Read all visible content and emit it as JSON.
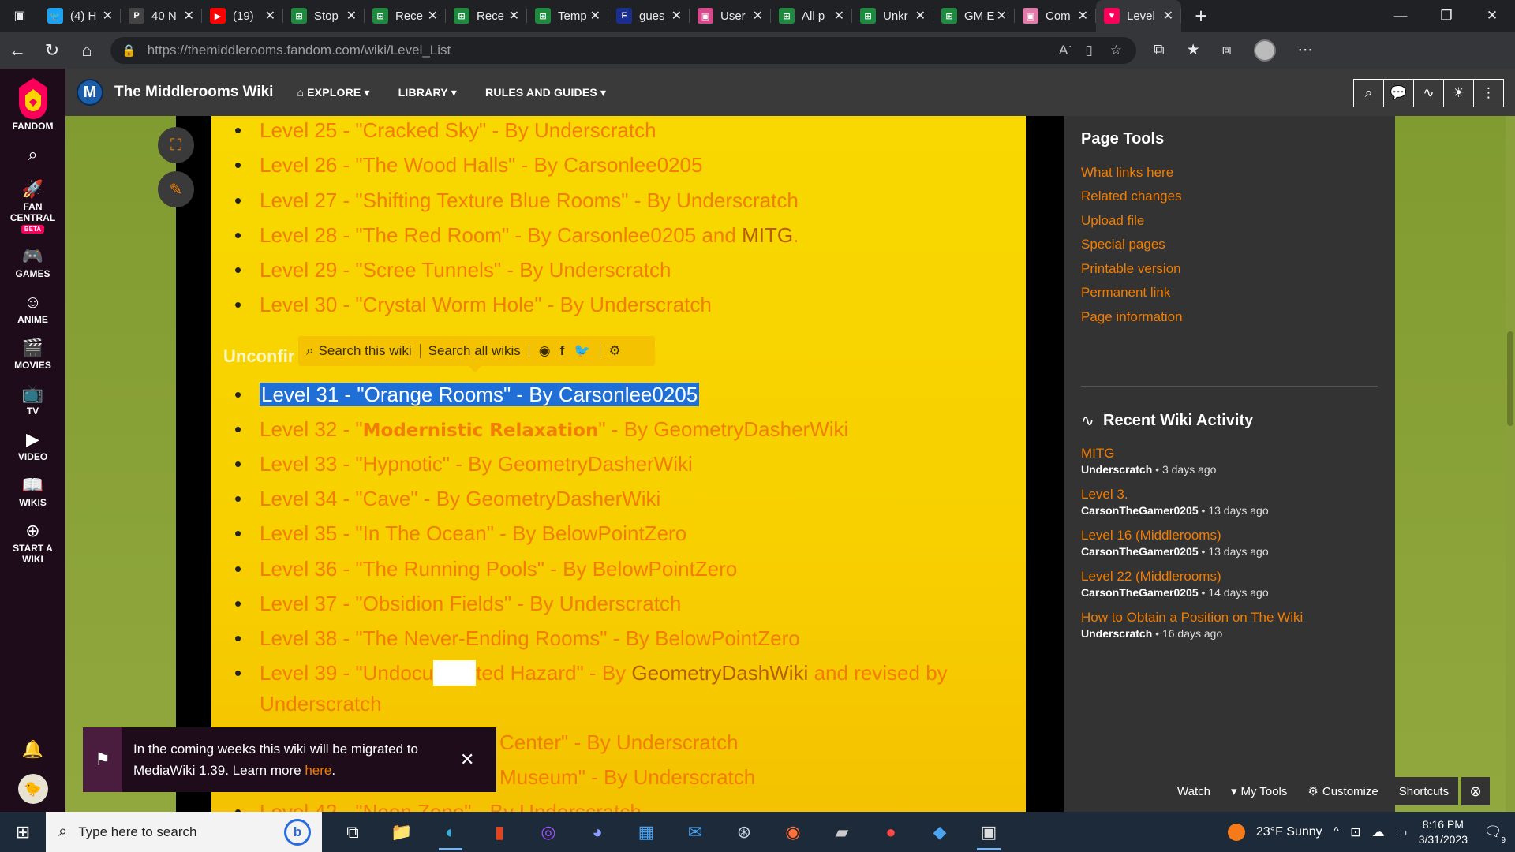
{
  "browser": {
    "tabs": [
      {
        "title": "(4) H",
        "favicon": "twitter-icon",
        "color": "#1da1f2",
        "glyph": "🐦"
      },
      {
        "title": "40 N",
        "favicon": "patreon-icon",
        "color": "#444",
        "glyph": "P"
      },
      {
        "title": "(19)",
        "favicon": "youtube-icon",
        "color": "#ff0000",
        "glyph": "▶"
      },
      {
        "title": "Stop",
        "favicon": "sheet-icon",
        "color": "#1f8a3f",
        "glyph": "⊞"
      },
      {
        "title": "Rece",
        "favicon": "sheet-icon",
        "color": "#1f8a3f",
        "glyph": "⊞"
      },
      {
        "title": "Rece",
        "favicon": "sheet-icon",
        "color": "#1f8a3f",
        "glyph": "⊞"
      },
      {
        "title": "Temp",
        "favicon": "sheet-icon",
        "color": "#1f8a3f",
        "glyph": "⊞"
      },
      {
        "title": "gues",
        "favicon": "fandom-tab-icon",
        "color": "#1a2f8f",
        "glyph": "F"
      },
      {
        "title": "User",
        "favicon": "wiki-tab-icon",
        "color": "#d44a8a",
        "glyph": "▣"
      },
      {
        "title": "All p",
        "favicon": "sheet-icon",
        "color": "#1f8a3f",
        "glyph": "⊞"
      },
      {
        "title": "Unkr",
        "favicon": "sheet-icon",
        "color": "#1f8a3f",
        "glyph": "⊞"
      },
      {
        "title": "GM E",
        "favicon": "sheet-icon",
        "color": "#1f8a3f",
        "glyph": "⊞"
      },
      {
        "title": "Com",
        "favicon": "wiki-tab-icon",
        "color": "#e07aa8",
        "glyph": "▣"
      },
      {
        "title": "Level",
        "favicon": "fandom-heart-icon",
        "color": "#fa005a",
        "glyph": "♥",
        "active": true
      }
    ],
    "url_domain": "https://themiddlerooms.fandom.com",
    "url_path": "/wiki/Level_List"
  },
  "fandom_nav": {
    "brand": "FANDOM",
    "items": [
      {
        "label": "FAN\nCENTRAL",
        "icon": "rocket-icon",
        "glyph": "🚀",
        "badge": "BETA"
      },
      {
        "label": "GAMES",
        "icon": "gamepad-icon",
        "glyph": "🎮"
      },
      {
        "label": "ANIME",
        "icon": "anime-icon",
        "glyph": "☺"
      },
      {
        "label": "MOVIES",
        "icon": "clapper-icon",
        "glyph": "🎬"
      },
      {
        "label": "TV",
        "icon": "tv-icon",
        "glyph": "📺"
      },
      {
        "label": "VIDEO",
        "icon": "video-icon",
        "glyph": "▶"
      },
      {
        "label": "WIKIS",
        "icon": "book-icon",
        "glyph": "📖"
      },
      {
        "label": "START A\nWIKI",
        "icon": "plus-circle-icon",
        "glyph": "⊕"
      }
    ]
  },
  "wiki_header": {
    "logo_letter": "M",
    "name": "The Middlerooms Wiki",
    "nav": [
      "EXPLORE",
      "LIBRARY",
      "RULES AND GUIDES"
    ]
  },
  "levels": [
    {
      "num": "Level 25",
      "name": "\"Cracked Sky\"",
      "by": "Underscratch"
    },
    {
      "num": "Level 26",
      "name": "\"The Wood Halls\"",
      "by": "Carsonlee0205"
    },
    {
      "num": "Level 27",
      "name": "\"Shifting Texture Blue Rooms\"",
      "by": "Underscratch"
    },
    {
      "num": "Level 28",
      "name": "\"The Red Room\"",
      "by": "Carsonlee0205 and",
      "extra_link": "MITG",
      "tail": "."
    },
    {
      "num": "Level 29",
      "name": "\"Scree Tunnels\"",
      "by": "Underscratch"
    },
    {
      "num": "Level 30",
      "name": "\"Crystal Worm Hole\"",
      "by": "Underscratch"
    },
    {
      "num": "Level 31",
      "name": "\"Orange Rooms\"",
      "by": "Carsonlee0205",
      "selected": true
    },
    {
      "num": "Level 32",
      "name_pre": "\"",
      "name_bold": "Modernistic Relaxation",
      "name_post": "\"",
      "by": "GeometryDasherWiki"
    },
    {
      "num": "Level 33",
      "name": "\"Hypnotic\"",
      "by": "GeometryDasherWiki"
    },
    {
      "num": "Level 34",
      "name": "\"Cave\"",
      "by": "GeometryDasherWiki"
    },
    {
      "num": "Level 35",
      "name": "\"In The Ocean\"",
      "by": "BelowPointZero"
    },
    {
      "num": "Level 36",
      "name": "\"The Running Pools\"",
      "by": "BelowPointZero"
    },
    {
      "num": "Level 37",
      "name": "\"Obsidion Fields\"",
      "by": "Underscratch"
    },
    {
      "num": "Level 38",
      "name": "\"The Never-Ending Rooms\"",
      "by": "BelowPointZero"
    },
    {
      "num": "Level 39",
      "name_pre": "\"Undocu",
      "name_post": "ted Hazard\"",
      "by_link": "GeometryDashWiki",
      "after": "and revised by",
      "line2": "Underscratch"
    },
    {
      "partial": "Center\" - By Underscratch"
    },
    {
      "partial": "Museum\" - By Underscratch"
    },
    {
      "partial": "Level 42 - \"Neon Zone\" - By Underscratch"
    }
  ],
  "level_sep": " - ",
  "level_by": "By",
  "unconfirmed_heading": "Unconfir",
  "search_popup": {
    "this_wiki": "Search this wiki",
    "all_wikis": "Search all wikis"
  },
  "page_tools": {
    "title": "Page Tools",
    "links": [
      "What links here",
      "Related changes",
      "Upload file",
      "Special pages",
      "Printable version",
      "Permanent link",
      "Page information"
    ]
  },
  "recent_activity": {
    "title": "Recent Wiki Activity",
    "items": [
      {
        "page": "MITG",
        "user": "Underscratch",
        "when": "3 days ago"
      },
      {
        "page": "Level 3.",
        "user": "CarsonTheGamer0205",
        "when": "13 days ago"
      },
      {
        "page": "Level 16 (Middlerooms)",
        "user": "CarsonTheGamer0205",
        "when": "13 days ago"
      },
      {
        "page": "Level 22 (Middlerooms)",
        "user": "CarsonTheGamer0205",
        "when": "14 days ago"
      },
      {
        "page": "How to Obtain a Position on The Wiki",
        "user": "Underscratch",
        "when": "16 days ago"
      }
    ]
  },
  "notice": {
    "text": "In the coming weeks this wiki will be migrated to MediaWiki 1.39. Learn more",
    "link": "here",
    "tail": "."
  },
  "bottom_tools": {
    "watch": "Watch",
    "my_tools": "My Tools",
    "customize": "Customize",
    "shortcuts": "Shortcuts"
  },
  "taskbar": {
    "search_placeholder": "Type here to search",
    "weather": "23°F  Sunny",
    "time": "8:16 PM",
    "date": "3/31/2023",
    "notif_count": "9"
  },
  "colors": {
    "link_orange": "#f27d00",
    "article_yellow": "#f8d800",
    "selection_blue": "#1f6fd6",
    "fandom_pink": "#fa005a"
  }
}
